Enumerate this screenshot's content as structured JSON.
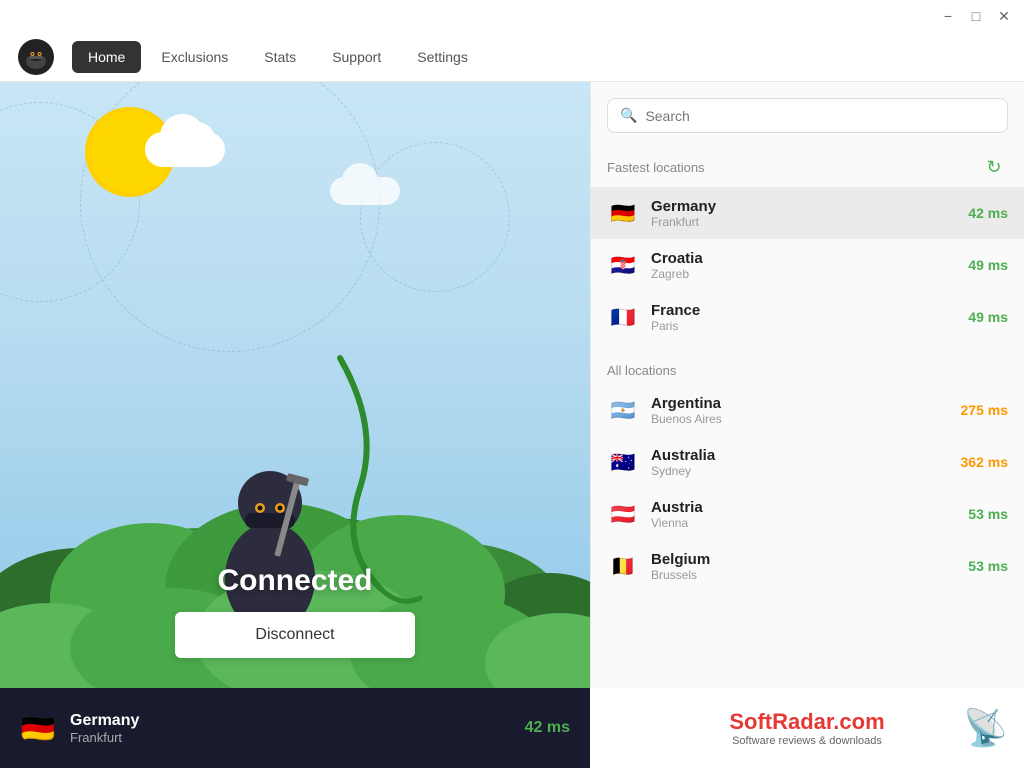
{
  "titlebar": {
    "minimize_label": "−",
    "maximize_label": "□",
    "close_label": "✕"
  },
  "nav": {
    "logo_alt": "HideMe VPN logo",
    "items": [
      {
        "id": "home",
        "label": "Home",
        "active": true
      },
      {
        "id": "exclusions",
        "label": "Exclusions",
        "active": false
      },
      {
        "id": "stats",
        "label": "Stats",
        "active": false
      },
      {
        "id": "support",
        "label": "Support",
        "active": false
      },
      {
        "id": "settings",
        "label": "Settings",
        "active": false
      }
    ]
  },
  "main": {
    "status_label": "Connected",
    "disconnect_label": "Disconnect"
  },
  "status_bar": {
    "country": "Germany",
    "city": "Frankfurt",
    "ping": "42 ms",
    "flag": "🇩🇪"
  },
  "search": {
    "placeholder": "Search"
  },
  "fastest_locations": {
    "section_title": "Fastest locations",
    "items": [
      {
        "country": "Germany",
        "city": "Frankfurt",
        "ping": "42 ms",
        "ping_class": "ping-green",
        "flag": "🇩🇪",
        "selected": true
      },
      {
        "country": "Croatia",
        "city": "Zagreb",
        "ping": "49 ms",
        "ping_class": "ping-green",
        "flag": "🇭🇷",
        "selected": false
      },
      {
        "country": "France",
        "city": "Paris",
        "ping": "49 ms",
        "ping_class": "ping-green",
        "flag": "🇫🇷",
        "selected": false
      }
    ]
  },
  "all_locations": {
    "section_title": "All locations",
    "items": [
      {
        "country": "Argentina",
        "city": "Buenos Aires",
        "ping": "275 ms",
        "ping_class": "ping-orange",
        "flag": "🇦🇷",
        "selected": false
      },
      {
        "country": "Australia",
        "city": "Sydney",
        "ping": "362 ms",
        "ping_class": "ping-orange",
        "flag": "🇦🇺",
        "selected": false
      },
      {
        "country": "Austria",
        "city": "Vienna",
        "ping": "53 ms",
        "ping_class": "ping-green",
        "flag": "🇦🇹",
        "selected": false
      },
      {
        "country": "Belgium",
        "city": "Brussels",
        "ping": "53 ms",
        "ping_class": "ping-green",
        "flag": "🇧🇪",
        "selected": false
      }
    ]
  },
  "watermark": {
    "title_main": "SoftRadar",
    "title_suffix": ".com",
    "subtitle": "Software reviews & downloads"
  }
}
